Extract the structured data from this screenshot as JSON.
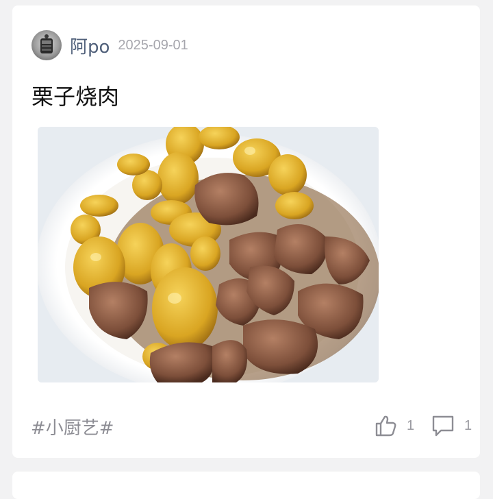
{
  "post": {
    "author": {
      "name": "阿po",
      "avatar_icon": "avatar-image"
    },
    "date": "2025-09-01",
    "title": "栗子烧肉",
    "image": {
      "subject": "braised-pork-with-chestnuts-photo"
    },
    "tag": "#小厨艺#",
    "likes": {
      "icon": "thumbs-up-icon",
      "count": "1"
    },
    "comments": {
      "icon": "comment-bubble-icon",
      "count": "1"
    }
  },
  "colors": {
    "page_background": "#f2f2f3",
    "card_background": "#ffffff",
    "author_name": "#50607a",
    "meta_gray": "#a6a6ad",
    "title_text": "#111111",
    "icon_gray": "#8d8d94"
  }
}
